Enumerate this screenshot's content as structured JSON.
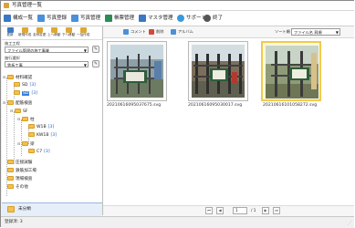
{
  "window": {
    "title": "写真管理一覧"
  },
  "menubar": {
    "items": [
      {
        "label": "構成一覧",
        "color": "#3b78c4"
      },
      {
        "label": "写真登録",
        "color": "#4a90d9"
      },
      {
        "label": "写真管理",
        "color": "#4a90d9"
      },
      {
        "label": "帳票管理",
        "color": "#2e8b57"
      },
      {
        "label": "マスタ管理",
        "color": "#3b78c4"
      },
      {
        "label": "サポート",
        "color": "#3a9ad9"
      },
      {
        "label": "終了",
        "color": "#555555"
      }
    ]
  },
  "left_toolbar": {
    "buttons": [
      {
        "label": "更新",
        "icon": "refresh-icon",
        "color": "#3b78c4"
      },
      {
        "label": "新規作成",
        "icon": "folder-add-icon",
        "color": "#e0a830"
      },
      {
        "label": "名称変更",
        "icon": "rename-icon",
        "color": "#e0a830"
      },
      {
        "label": "上へ移動",
        "icon": "up-icon",
        "color": "#e0a830"
      },
      {
        "label": "下へ移動",
        "icon": "down-icon",
        "color": "#e0a830"
      },
      {
        "label": "一括作成",
        "icon": "batch-icon",
        "color": "#e0a830"
      }
    ]
  },
  "filters": {
    "label1": "施工工程",
    "select1": "ファイル管理の施工事業",
    "label2": "施行選択",
    "select2": "鉄板工事"
  },
  "tree": {
    "nodes": [
      {
        "label": "材料確認",
        "count": ""
      },
      {
        "label": "SD",
        "count": "[3]"
      },
      {
        "label": "SD",
        "count": "[3]"
      },
      {
        "label": "配筋検査",
        "count": ""
      },
      {
        "label": "SF",
        "count": ""
      },
      {
        "label": "柱",
        "count": ""
      },
      {
        "label": "W1B",
        "count": "[3]"
      },
      {
        "label": "KW1B",
        "count": "[3]"
      },
      {
        "label": "梁",
        "count": ""
      },
      {
        "label": "C7",
        "count": "[3]"
      },
      {
        "label": "圧接試験",
        "count": ""
      },
      {
        "label": "鉄筋加工場",
        "count": ""
      },
      {
        "label": "現場検査",
        "count": ""
      },
      {
        "label": "その他",
        "count": ""
      }
    ]
  },
  "left_bottom": {
    "label": "未分類"
  },
  "right_toolbar": {
    "buttons": [
      {
        "label": "コメント",
        "icon": "comment-icon",
        "color": "#4a90d9"
      },
      {
        "label": "削除",
        "icon": "delete-icon",
        "color": "#d04a3a"
      },
      {
        "label": "アルバム",
        "icon": "album-icon",
        "color": "#4a90d9"
      }
    ],
    "sort_label": "ソート順",
    "sort_value": "ファイル名 昇順"
  },
  "thumbnails": [
    {
      "filename": "20210616095037675.svg"
    },
    {
      "filename": "20210616095030017.svg"
    },
    {
      "filename": "20210616101058272.svg"
    }
  ],
  "pager": {
    "page": "1",
    "total": "/ 1"
  },
  "status": {
    "text": "登録済: 3"
  }
}
